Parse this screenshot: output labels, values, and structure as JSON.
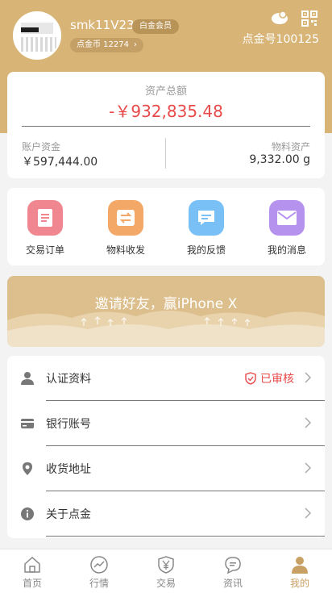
{
  "profile": {
    "username": "smk11V23",
    "member_level": "白金会员",
    "coin_label": "点金币 12274",
    "account_no": "点金号100125"
  },
  "assets": {
    "title": "资产总额",
    "total": "-￥932,835.48",
    "fund_label": "账户资金",
    "fund_value": "￥597,444.00",
    "material_label": "物料资产",
    "material_value": "9,332.00 g"
  },
  "quick_actions": [
    {
      "label": "交易订单",
      "icon": "document-icon",
      "color": "#f08790"
    },
    {
      "label": "物料收发",
      "icon": "transfer-icon",
      "color": "#f3a867"
    },
    {
      "label": "我的反馈",
      "icon": "feedback-icon",
      "color": "#79c0f6"
    },
    {
      "label": "我的消息",
      "icon": "mail-icon",
      "color": "#b492ee"
    }
  ],
  "banner": {
    "text": "邀请好友，赢iPhone X"
  },
  "menu": [
    {
      "label": "认证资料",
      "icon": "user-icon",
      "status": "已审核"
    },
    {
      "label": "银行账号",
      "icon": "card-icon"
    },
    {
      "label": "收货地址",
      "icon": "location-icon"
    },
    {
      "label": "关于点金",
      "icon": "info-icon"
    }
  ],
  "tabs": [
    {
      "label": "首页",
      "icon": "home-icon"
    },
    {
      "label": "行情",
      "icon": "chart-icon"
    },
    {
      "label": "交易",
      "icon": "yen-shield-icon"
    },
    {
      "label": "资讯",
      "icon": "chat-icon"
    },
    {
      "label": "我的",
      "icon": "profile-icon",
      "active": true
    }
  ],
  "colors": {
    "brand": "#d8b476",
    "negative": "#e84a4a",
    "active_tab": "#c9a063"
  }
}
